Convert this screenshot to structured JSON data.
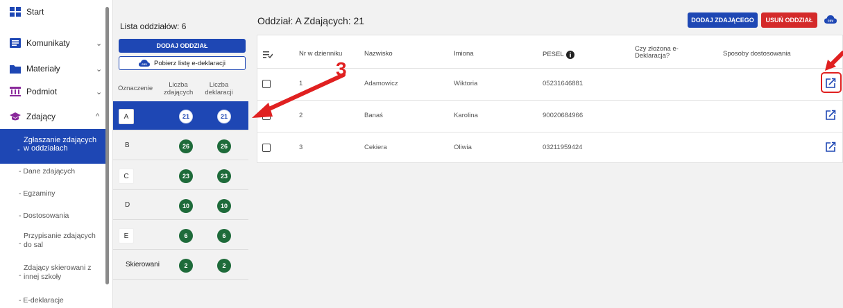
{
  "sidebar": {
    "items": [
      {
        "label": "Start",
        "icon": "grid-icon",
        "color": "#1e47b4",
        "chevron": ""
      },
      {
        "label": "Komunikaty",
        "icon": "message-icon",
        "color": "#1e47b4",
        "chevron": "⌄"
      },
      {
        "label": "Materiały",
        "icon": "folder-icon",
        "color": "#1e47b4",
        "chevron": "⌄"
      },
      {
        "label": "Podmiot",
        "icon": "institution-icon",
        "color": "#8a2a9b",
        "chevron": "⌄"
      },
      {
        "label": "Zdający",
        "icon": "graduation-cap-icon",
        "color": "#8a2a9b",
        "chevron": "^"
      }
    ],
    "subitems": [
      "Zgłaszanie zdających w oddziałach",
      "- Dane zdających",
      "- Egzaminy",
      "- Dostosowania",
      "Przypisanie zdających do sal",
      "Zdający skierowani z innej szkoły",
      "- E-deklaracje"
    ]
  },
  "groups_panel": {
    "title": "Lista oddziałów: 6",
    "add_button": "DODAJ ODDZIAŁ",
    "download_button": "Pobierz listę e-deklaracji",
    "csv_icon_label": "csv",
    "headers": {
      "label": "Oznaczenie",
      "students": "Liczba zdających",
      "declarations": "Liczba deklaracji"
    },
    "rows": [
      {
        "name": "A",
        "students": "21",
        "declarations": "21",
        "active": true
      },
      {
        "name": "B",
        "students": "26",
        "declarations": "26",
        "active": false
      },
      {
        "name": "C",
        "students": "23",
        "declarations": "23",
        "active": false
      },
      {
        "name": "D",
        "students": "10",
        "declarations": "10",
        "active": false
      },
      {
        "name": "E",
        "students": "6",
        "declarations": "6",
        "active": false
      },
      {
        "name": "Skierowani",
        "students": "2",
        "declarations": "2",
        "active": false
      }
    ]
  },
  "main": {
    "title": "Oddział: A Zdających: 21",
    "add_student_button": "DODAJ ZDAJĄCEGO",
    "delete_group_button": "USUŃ ODDZIAŁ",
    "csv_icon_label": "csv",
    "columns": [
      "Nr w dzienniku",
      "Nazwisko",
      "Imiona",
      "PESEL",
      "Czy złożona e-Deklaracja?",
      "Sposoby dostosowania"
    ],
    "rows": [
      {
        "nr": "1",
        "surname": "Adamowicz",
        "names": "Wiktoria",
        "pesel": "05231646881"
      },
      {
        "nr": "2",
        "surname": "Banaś",
        "names": "Karolina",
        "pesel": "90020684966"
      },
      {
        "nr": "3",
        "surname": "Cekiera",
        "names": "Oliwia",
        "pesel": "03211959424"
      }
    ]
  },
  "annotation": {
    "step_number": "3"
  },
  "colors": {
    "primary": "#1e47b4",
    "danger": "#d42a2a",
    "success": "#1e6b3a",
    "annotation": "#e02020"
  }
}
